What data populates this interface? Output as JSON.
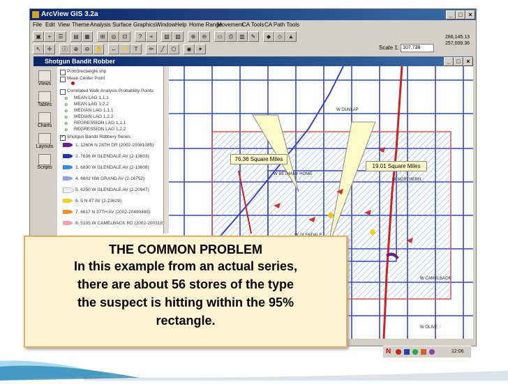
{
  "app": {
    "title": "ArcView GIS 3.2a",
    "window_buttons": [
      "_",
      "□",
      "×"
    ]
  },
  "menubar": [
    "File",
    "Edit",
    "View",
    "Theme",
    "Analysis",
    "Surface",
    "Graphics",
    "Window",
    "Help",
    "Home Range",
    "Movement",
    "CA Tools",
    "CA Path Tools"
  ],
  "toolbar": {
    "scale_label": "Scale 1:",
    "scale_value": "107,738",
    "coord_x": "286,145.13",
    "coord_y": "257,009.36"
  },
  "view": {
    "title": "Shotgun Bandit Robber",
    "left_panel": [
      "Views",
      "Tables",
      "Charts",
      "Layouts",
      "Scripts"
    ]
  },
  "toc": {
    "layers": [
      {
        "label": "Prob3rectangle.shp"
      },
      {
        "label": "Mean Center Point"
      },
      {
        "label": "Correlated Walk Analysis Probability Points"
      },
      {
        "label": "MEAN LAG 1,1,1"
      },
      {
        "label": "MEAN LAG 1,2,2"
      },
      {
        "label": "MEDIAN LAG 1,1,1"
      },
      {
        "label": "MEDIAN LAG 1,2,2"
      },
      {
        "label": "REGRESSION LAG 1,1,1"
      },
      {
        "label": "REGRESSION LAG 1,2,2"
      },
      {
        "label": "Shotgun Bandit Robbery Series"
      },
      {
        "label": "1. 12606 N 28TH DR (2002-20081085)"
      },
      {
        "label": "2. 7636 W GLENDALE AV (2-13603)"
      },
      {
        "label": "3. 6830 W GLENDALE AV (2-13608)"
      },
      {
        "label": "4. 6602 NW GRAND AV (2-16752)"
      },
      {
        "label": "5. 6250 W GLENDALE AV (2-20947)"
      },
      {
        "label": "6. 5 N 47 AV (2-23629)"
      },
      {
        "label": "7. 6617 N 27TH AV (2002-20490495)"
      },
      {
        "label": "8. 5105 W CAMELBACK RD (2002-200318)"
      }
    ]
  },
  "map": {
    "callout_left": "76.36 Square Miles",
    "callout_right": "19.01 Square Miles",
    "street_labels": [
      "W BETHANY HOME",
      "W GLENDALE",
      "W CAMELBACK",
      "W DUNLAP",
      "W NORTHERN",
      "W OLIVE"
    ]
  },
  "overlay": {
    "heading": "THE COMMON PROBLEM",
    "lines": [
      "In this example from an actual series,",
      "there are about 56 stores of the type",
      "the suspect is hitting within the 95%",
      "rectangle."
    ]
  },
  "taskbar": {
    "time": "12:06"
  },
  "colors": {
    "titlebar": "#0a246a",
    "street_blue": "#3344cc",
    "highway_red": "#cc2222",
    "rect_red": "#e05050",
    "overlay_bg": "#fff3d4"
  }
}
